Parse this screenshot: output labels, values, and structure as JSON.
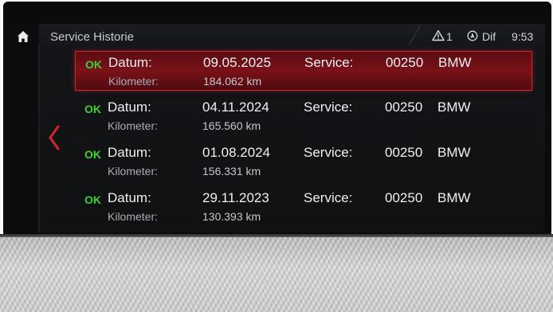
{
  "header": {
    "title": "Service Historie",
    "warning_count": "1",
    "destination": "Dif",
    "clock": "9:53"
  },
  "rows": [
    {
      "status": "OK",
      "date_label": "Datum:",
      "date": "09.05.2025",
      "service_label": "Service:",
      "code": "00250",
      "brand": "BMW",
      "km_label": "Kilometer:",
      "km": "184.062 km"
    },
    {
      "status": "OK",
      "date_label": "Datum:",
      "date": "04.11.2024",
      "service_label": "Service:",
      "code": "00250",
      "brand": "BMW",
      "km_label": "Kilometer:",
      "km": "165.560 km"
    },
    {
      "status": "OK",
      "date_label": "Datum:",
      "date": "01.08.2024",
      "service_label": "Service:",
      "code": "00250",
      "brand": "BMW",
      "km_label": "Kilometer:",
      "km": "156.331 km"
    },
    {
      "status": "OK",
      "date_label": "Datum:",
      "date": "29.11.2023",
      "service_label": "Service:",
      "code": "00250",
      "brand": "BMW",
      "km_label": "Kilometer:",
      "km": "130.393 km"
    }
  ],
  "colors": {
    "ok": "#41d13a",
    "selection": "#7a1118",
    "back_arrow": "#d2222c"
  },
  "icons": {
    "home": "home-icon",
    "back": "chevron-left-icon",
    "warning": "warning-triangle-icon",
    "navigation": "navigation-compass-icon"
  }
}
